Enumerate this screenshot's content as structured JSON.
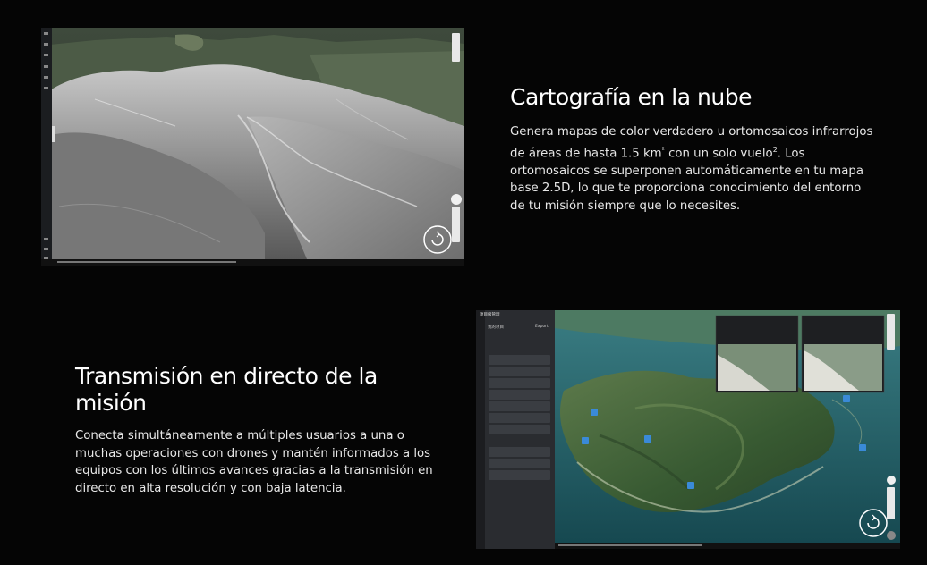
{
  "sections": [
    {
      "title": "Cartografía en la nube",
      "body_parts": [
        "Genera mapas de color verdadero u ortomosaicos infrarrojos de áreas de hasta 1.5 km",
        "²",
        " con un solo vuelo",
        "2",
        ". Los ortomosaicos se superponen automáticamente en tu mapa base 2.5D, lo que te proporciona conocimiento del entorno de tu misión siempre que lo necesites."
      ]
    },
    {
      "title": "Transmisión en directo de la misión",
      "body": "Conecta simultáneamente a múltiples usuarios a una o muchas operaciones con drones y mantén informados a los equipos con los últimos avances gracias a la transmisión en directo en alta resolución y con baja latencia."
    }
  ],
  "shot2_panel": {
    "header": "项目级管理",
    "subheader": "我的项目",
    "export_label": "Export"
  },
  "colors": {
    "background": "#050505",
    "text": "#ffffff",
    "panel": "#2a2c30"
  }
}
